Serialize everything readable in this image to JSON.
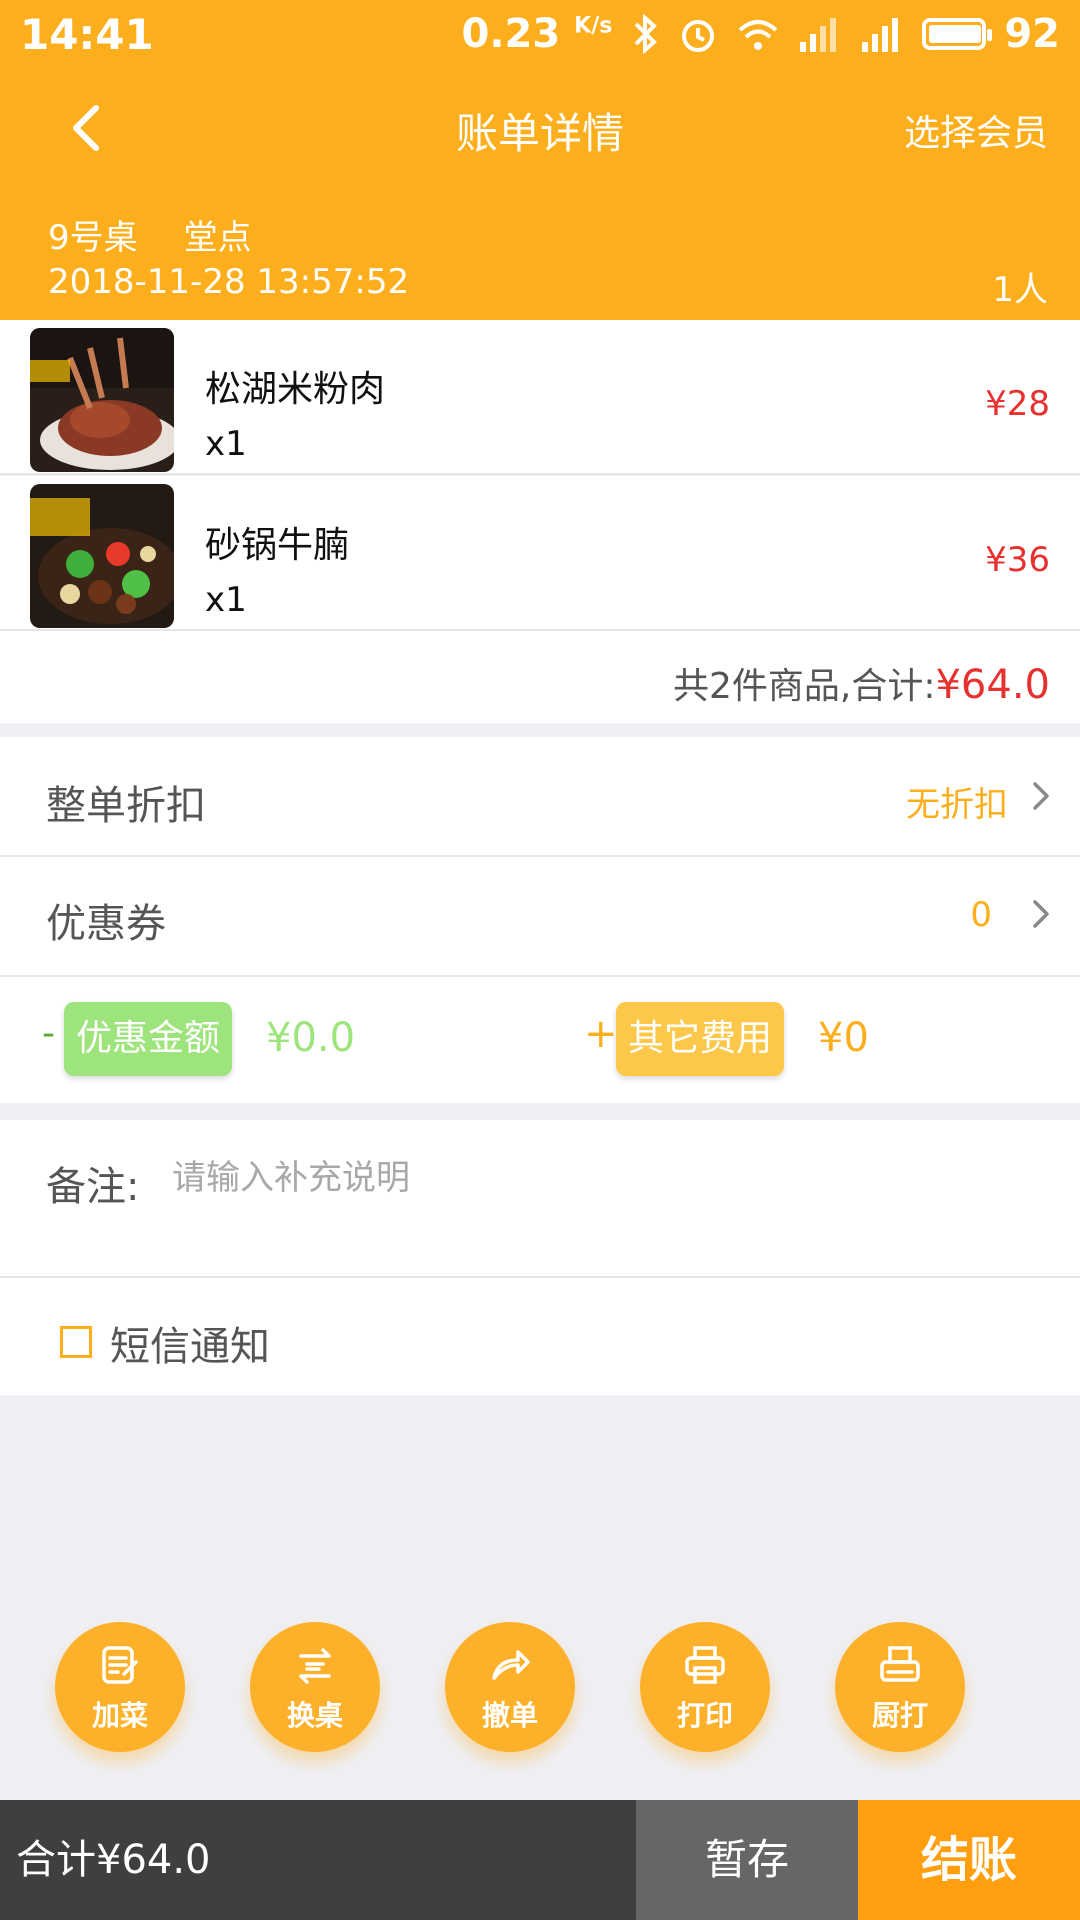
{
  "status_bar": {
    "time": "14:41",
    "net_speed": "0.23",
    "net_unit": "K/s",
    "battery": "92",
    "battery_level": 0.92
  },
  "header": {
    "title": "账单详情",
    "member_label": "选择会员"
  },
  "order": {
    "table": "9号桌",
    "type": "堂点",
    "datetime": "2018-11-28 13:57:52",
    "people": "1人"
  },
  "dishes": [
    {
      "name": "松湖米粉肉",
      "qty": "x1",
      "price": "¥28"
    },
    {
      "name": "砂锅牛腩",
      "qty": "x1",
      "price": "¥36"
    }
  ],
  "summary": {
    "text": "共2件商品,合计:",
    "amount": "¥64.0"
  },
  "discount": {
    "label": "整单折扣",
    "value": "无折扣"
  },
  "coupon": {
    "label": "优惠券",
    "value": "0"
  },
  "adjust": {
    "minus_sign": "-",
    "discount_tag": "优惠金额",
    "discount_amount": "¥0.0",
    "plus_sign": "+",
    "other_tag": "其它费用",
    "other_amount": "¥0"
  },
  "note": {
    "label": "备注:",
    "placeholder": "请输入补充说明"
  },
  "sms": {
    "label": "短信通知"
  },
  "actions": [
    {
      "label": "加菜",
      "icon": "add-dish-icon"
    },
    {
      "label": "换桌",
      "icon": "swap-table-icon"
    },
    {
      "label": "撤单",
      "icon": "undo-order-icon"
    },
    {
      "label": "打印",
      "icon": "printer-icon"
    },
    {
      "label": "厨打",
      "icon": "kitchen-print-icon"
    }
  ],
  "footer": {
    "total": "合计¥64.0",
    "save": "暂存",
    "checkout": "结账"
  },
  "colors": {
    "brand": "#fdae1d",
    "price_red": "#e6312f",
    "green_tag": "#9ee47c"
  }
}
